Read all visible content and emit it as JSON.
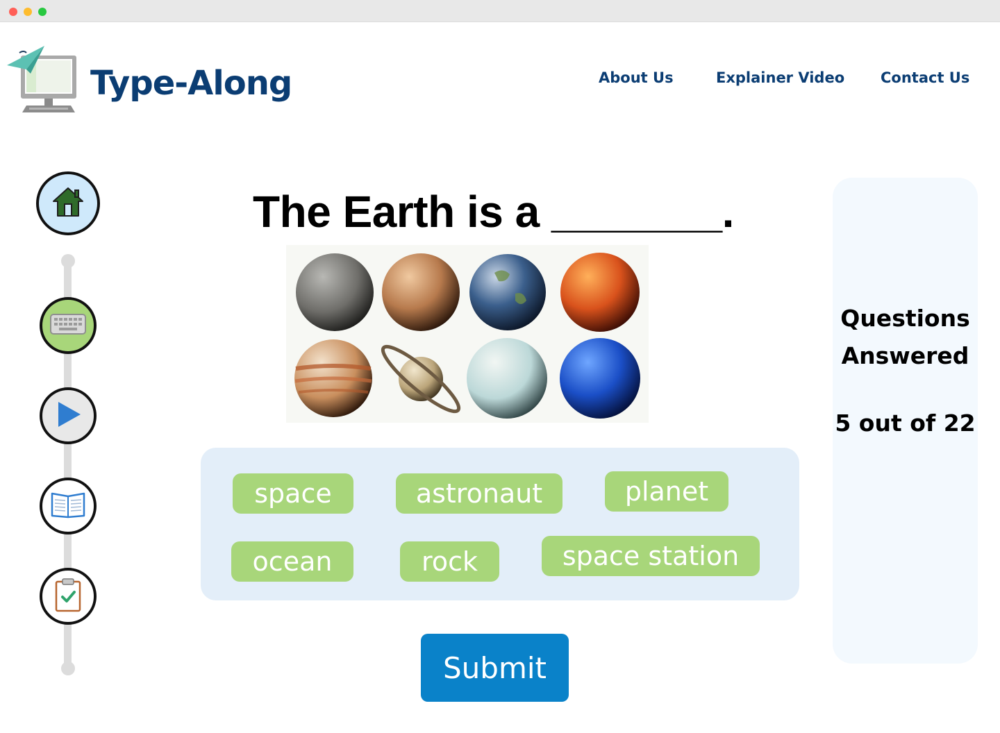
{
  "header": {
    "brand": "Type-Along",
    "nav": {
      "about": "About Us",
      "video": "Explainer Video",
      "contact": "Contact Us"
    }
  },
  "sidebar": {
    "steps": [
      {
        "icon": "home-icon"
      },
      {
        "icon": "keyboard-icon"
      },
      {
        "icon": "play-icon"
      },
      {
        "icon": "book-icon"
      },
      {
        "icon": "clipboard-check-icon"
      }
    ]
  },
  "question": {
    "text": "The Earth is a _______."
  },
  "word_bank": {
    "words": [
      "space",
      "astronaut",
      "planet",
      "ocean",
      "rock",
      "space station"
    ]
  },
  "submit_label": "Submit",
  "progress": {
    "title_line1": "Questions",
    "title_line2": "Answered",
    "count": "5 out of 22",
    "answered": 5,
    "total": 22
  },
  "colors": {
    "brand": "#0b3d73",
    "chip": "#a8d67a",
    "submit": "#0a82c9",
    "word_bank_bg": "#e3eef9",
    "panel_bg": "#f3f9fe"
  }
}
